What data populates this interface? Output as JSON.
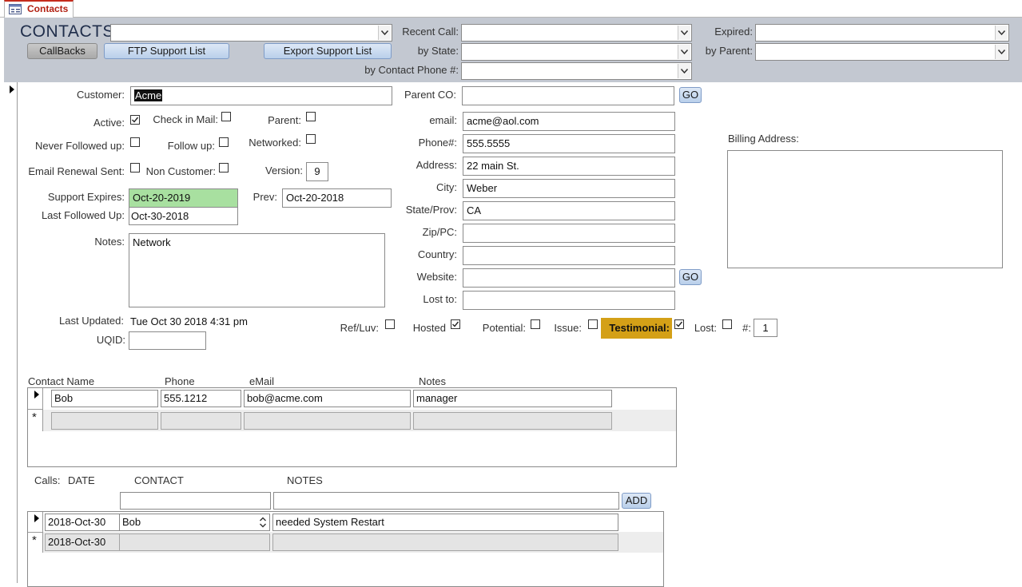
{
  "tab": {
    "label": "Contacts"
  },
  "header": {
    "title": "CONTACTS",
    "buttons": {
      "callbacks": "CallBacks",
      "ftp_support_list": "FTP Support List",
      "export_support_list": "Export Support List"
    },
    "filters": {
      "recent_call": "Recent Call:",
      "by_state": "by State:",
      "by_contact_phone": "by Contact Phone #:",
      "expired": "Expired:",
      "by_parent": "by Parent:"
    }
  },
  "form": {
    "customer": {
      "label": "Customer:",
      "value": "Acme"
    },
    "parent_co": {
      "label": "Parent CO:",
      "value": "",
      "go": "GO"
    },
    "active": {
      "label": "Active:",
      "checked": true
    },
    "check_in_mail": {
      "label": "Check in Mail:",
      "checked": false
    },
    "parent": {
      "label": "Parent:",
      "checked": false
    },
    "never_followed_up": {
      "label": "Never Followed up:",
      "checked": false
    },
    "follow_up": {
      "label": "Follow up:",
      "checked": false
    },
    "networked": {
      "label": "Networked:",
      "checked": false
    },
    "email_renewal_sent": {
      "label": "Email Renewal Sent:",
      "checked": false
    },
    "non_customer": {
      "label": "Non Customer:",
      "checked": false
    },
    "version": {
      "label": "Version:",
      "value": "9"
    },
    "support_expires": {
      "label": "Support Expires:",
      "value": "Oct-20-2019"
    },
    "prev": {
      "label": "Prev:",
      "value": "Oct-20-2018"
    },
    "last_followed_up": {
      "label": "Last Followed Up:",
      "value": "Oct-30-2018"
    },
    "notes": {
      "label": "Notes:",
      "value": "Network"
    },
    "email": {
      "label": "email:",
      "value": "acme@aol.com"
    },
    "phone": {
      "label": "Phone#:",
      "value": "555.5555"
    },
    "address": {
      "label": "Address:",
      "value": "22 main St."
    },
    "city": {
      "label": "City:",
      "value": "Weber"
    },
    "state_prov": {
      "label": "State/Prov:",
      "value": "CA"
    },
    "zip_pc": {
      "label": "Zip/PC:",
      "value": ""
    },
    "country": {
      "label": "Country:",
      "value": ""
    },
    "website": {
      "label": "Website:",
      "value": "",
      "go": "GO"
    },
    "lost_to": {
      "label": "Lost to:",
      "value": ""
    },
    "billing_address": {
      "label": "Billing Address:",
      "value": ""
    },
    "last_updated": {
      "label": "Last Updated:",
      "value": "Tue Oct 30 2018 4:31 pm"
    },
    "uqid": {
      "label": "UQID:",
      "value": ""
    },
    "ref_luv": {
      "label": "Ref/Luv:",
      "checked": false
    },
    "hosted": {
      "label": "Hosted",
      "checked": true
    },
    "potential": {
      "label": "Potential:",
      "checked": false
    },
    "issue": {
      "label": "Issue:",
      "checked": false
    },
    "testimonial": {
      "label": "Testimonial:",
      "checked": true
    },
    "lost": {
      "label": "Lost:",
      "checked": false
    },
    "number": {
      "label": "#:",
      "value": "1"
    }
  },
  "contacts": {
    "columns": [
      "Contact Name",
      "Phone",
      "eMail",
      "Notes"
    ],
    "rows": [
      {
        "name": "Bob",
        "phone": "555.1212",
        "email": "bob@acme.com",
        "notes": "manager"
      }
    ]
  },
  "calls": {
    "label": "Calls:",
    "columns": [
      "DATE",
      "CONTACT",
      "NOTES"
    ],
    "add_button": "ADD",
    "rows": [
      {
        "date": "2018-Oct-30",
        "contact": "Bob",
        "notes": "needed System Restart"
      }
    ],
    "new_row_date": "2018-Oct-30"
  },
  "colors": {
    "header_band": "#c3c8d1",
    "support_expires_bg": "#a8e0a0",
    "testimonial_bg": "#d4a017",
    "tab_accent": "#c42b1c"
  }
}
